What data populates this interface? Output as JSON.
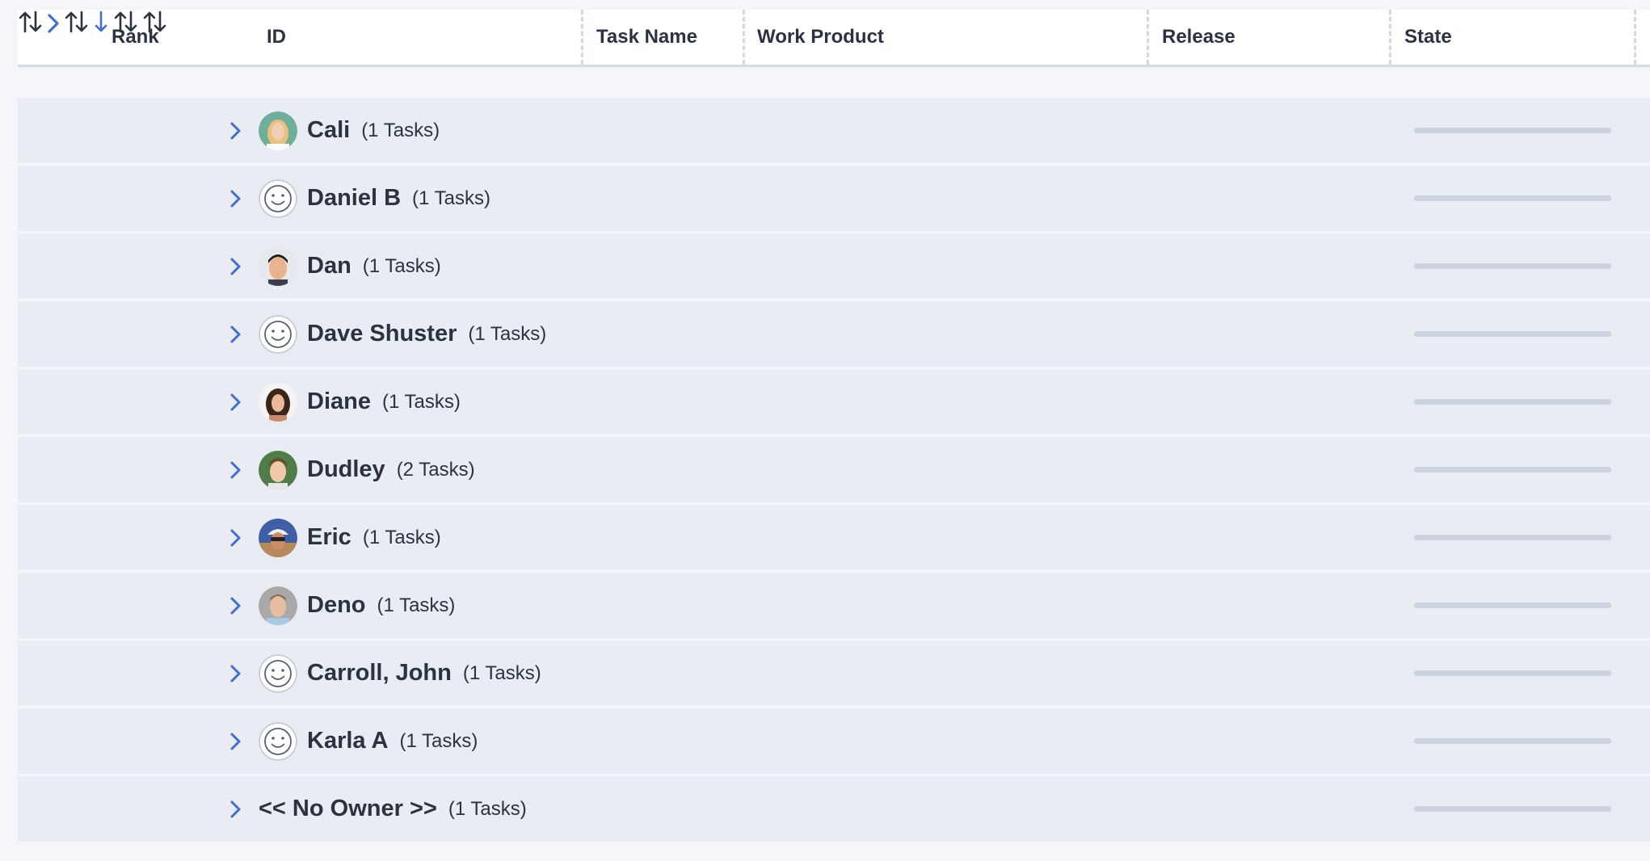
{
  "columns": {
    "rank": "Rank",
    "id": "ID",
    "task_name": "Task Name",
    "work_product": "Work Product",
    "release": "Release",
    "state": "State"
  },
  "groups": [
    {
      "owner": "Cali",
      "count": "(1 Tasks)",
      "avatar": "photo-avatar",
      "state_progress": 0
    },
    {
      "owner": "Daniel B",
      "count": "(1 Tasks)",
      "avatar": "default-smiley-avatar",
      "state_progress": 0
    },
    {
      "owner": "Dan",
      "count": "(1 Tasks)",
      "avatar": "photo-avatar",
      "state_progress": 0
    },
    {
      "owner": "Dave Shuster",
      "count": "(1 Tasks)",
      "avatar": "default-smiley-avatar",
      "state_progress": 0
    },
    {
      "owner": "Diane",
      "count": "(1 Tasks)",
      "avatar": "photo-avatar",
      "state_progress": 0
    },
    {
      "owner": "Dudley",
      "count": "(2 Tasks)",
      "avatar": "photo-avatar",
      "state_progress": 0
    },
    {
      "owner": "Eric",
      "count": "(1 Tasks)",
      "avatar": "photo-avatar",
      "state_progress": 0
    },
    {
      "owner": "Deno",
      "count": "(1 Tasks)",
      "avatar": "photo-avatar",
      "state_progress": 0
    },
    {
      "owner": "Carroll, John",
      "count": "(1 Tasks)",
      "avatar": "default-smiley-avatar",
      "state_progress": 0
    },
    {
      "owner": "Karla A",
      "count": "(1 Tasks)",
      "avatar": "default-smiley-avatar",
      "state_progress": 0
    },
    {
      "owner": "<< No Owner >>",
      "count": "(1 Tasks)",
      "avatar": "none",
      "state_progress": 0
    }
  ],
  "colors": {
    "accent": "#3f6fd0",
    "row_bg": "#e9ecf2",
    "header_bg": "#ffffff",
    "page_bg": "#f4f6fa"
  }
}
